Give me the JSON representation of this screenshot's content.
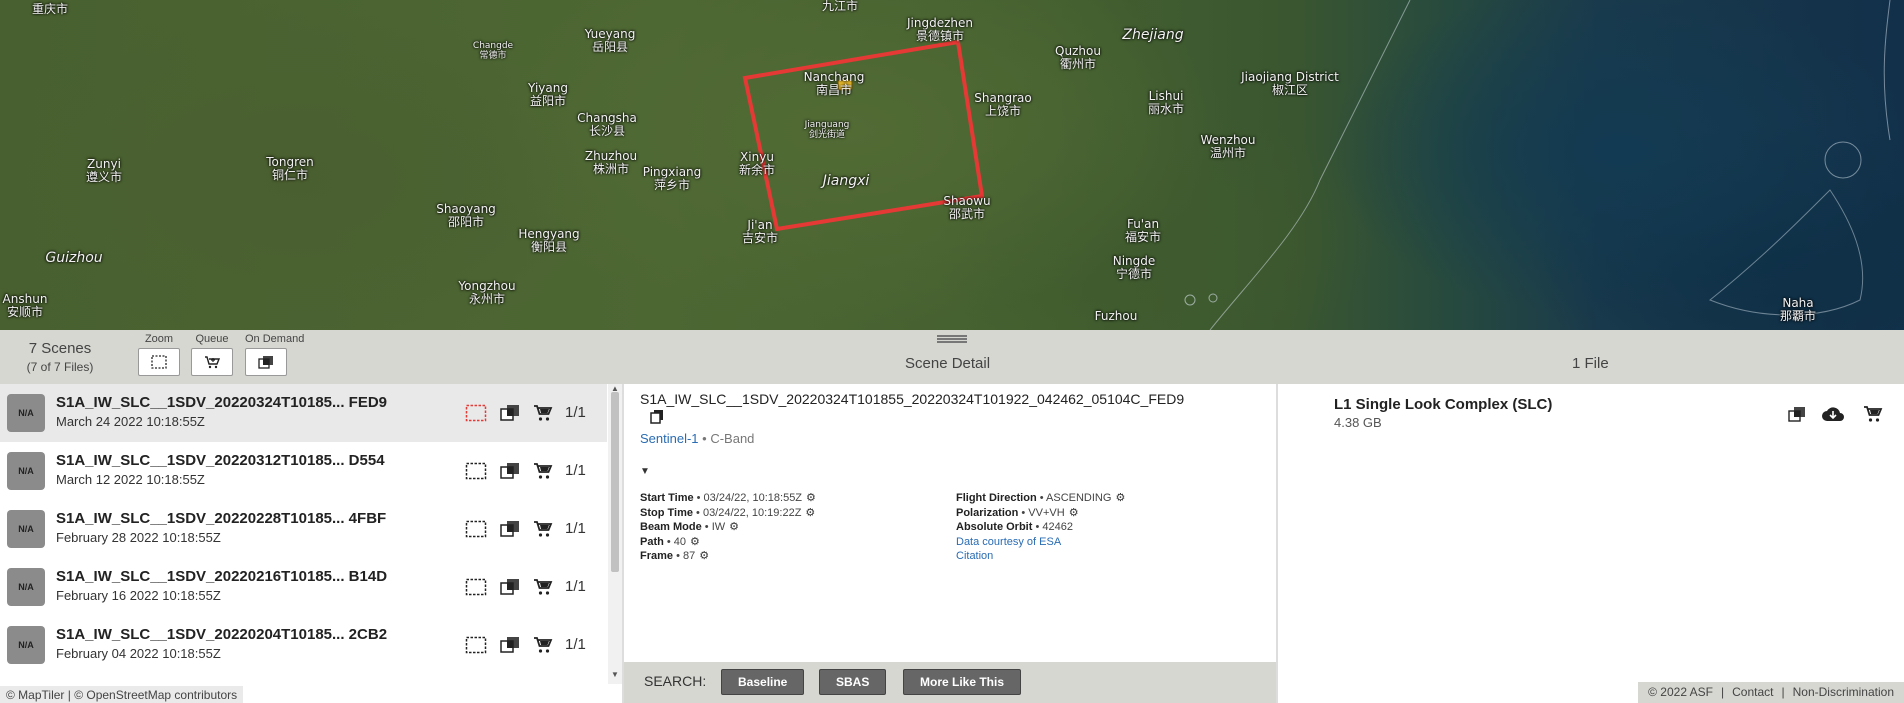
{
  "map": {
    "cities": [
      {
        "name": "重庆市",
        "sm": false
      },
      {
        "name": "Changde\n常德市",
        "sm": true
      },
      {
        "name": "Yueyang\n岳阳县",
        "sm": false
      },
      {
        "name": "九江市",
        "sm": false
      },
      {
        "name": "Jingdezhen\n景德镇市",
        "sm": false
      },
      {
        "name": "Quzhou\n衢州市",
        "sm": false
      },
      {
        "name": "Zhejiang",
        "sm": false,
        "prov": true
      },
      {
        "name": "Yiyang\n益阳市",
        "sm": false
      },
      {
        "name": "Nanchang\n南昌市",
        "sm": false
      },
      {
        "name": "Shangrao\n上饶市",
        "sm": false
      },
      {
        "name": "Lishui\n丽水市",
        "sm": false
      },
      {
        "name": "Jiaojiang District\n椒江区",
        "sm": false
      },
      {
        "name": "Changsha\n长沙县",
        "sm": false
      },
      {
        "name": "Jianguang\n剑光街道",
        "sm": true
      },
      {
        "name": "Wenzhou\n温州市",
        "sm": false
      },
      {
        "name": "Zunyi\n遵义市",
        "sm": false
      },
      {
        "name": "Tongren\n铜仁市",
        "sm": false
      },
      {
        "name": "Zhuzhou\n株洲市",
        "sm": false
      },
      {
        "name": "Pingxiang\n萍乡市",
        "sm": false
      },
      {
        "name": "Xinyu\n新余市",
        "sm": false
      },
      {
        "name": "Jiangxi",
        "sm": false,
        "prov": true
      },
      {
        "name": "Shaoyang\n邵阳市",
        "sm": false
      },
      {
        "name": "Shaowu\n邵武市",
        "sm": false
      },
      {
        "name": "Fu'an\n福安市",
        "sm": false
      },
      {
        "name": "Guizhou",
        "sm": false,
        "prov": true
      },
      {
        "name": "Hengyang\n衡阳县",
        "sm": false
      },
      {
        "name": "Ji'an\n吉安市",
        "sm": false
      },
      {
        "name": "Ningde\n宁德市",
        "sm": false
      },
      {
        "name": "Anshun\n安顺市",
        "sm": false
      },
      {
        "name": "Yongzhou\n永州市",
        "sm": false
      },
      {
        "name": "Fuzhou",
        "sm": false
      },
      {
        "name": "Naha\n那覇市",
        "sm": false
      }
    ],
    "attribution": [
      "© MapTiler",
      "© OpenStreetMap contributors"
    ],
    "footprint_color": "#e53935"
  },
  "toolbar": {
    "scene_count": "7 Scenes",
    "file_count": "(7 of 7 Files)",
    "zoom_label": "Zoom",
    "queue_label": "Queue",
    "ondemand_label": "On Demand",
    "scene_detail_title": "Scene Detail",
    "files_title": "1 File"
  },
  "scenes": [
    {
      "name": "S1A_IW_SLC__1SDV_20220324T10185... FED9",
      "date": "March 24 2022 10:18:55Z",
      "count": "1/1",
      "thumb": "N/A",
      "selected": true
    },
    {
      "name": "S1A_IW_SLC__1SDV_20220312T10185... D554",
      "date": "March 12 2022 10:18:55Z",
      "count": "1/1",
      "thumb": "N/A",
      "selected": false
    },
    {
      "name": "S1A_IW_SLC__1SDV_20220228T10185... 4FBF",
      "date": "February 28 2022 10:18:55Z",
      "count": "1/1",
      "thumb": "N/A",
      "selected": false
    },
    {
      "name": "S1A_IW_SLC__1SDV_20220216T10185... B14D",
      "date": "February 16 2022 10:18:55Z",
      "count": "1/1",
      "thumb": "N/A",
      "selected": false
    },
    {
      "name": "S1A_IW_SLC__1SDV_20220204T10185... 2CB2",
      "date": "February 04 2022 10:18:55Z",
      "count": "1/1",
      "thumb": "N/A",
      "selected": false
    }
  ],
  "detail": {
    "full_name": "S1A_IW_SLC__1SDV_20220324T101855_20220324T101922_042462_05104C_FED9",
    "mission": "Sentinel-1",
    "band": " • C-Band",
    "toggle": "▼",
    "left_props": [
      {
        "k": "Start Time",
        "v": " • 03/24/22, 10:18:55Z"
      },
      {
        "k": "Stop Time",
        "v": " • 03/24/22, 10:19:22Z"
      },
      {
        "k": "Beam Mode",
        "v": " • IW"
      },
      {
        "k": "Path",
        "v": " • 40"
      },
      {
        "k": "Frame",
        "v": " • 87"
      }
    ],
    "right_props": [
      {
        "k": "Flight Direction",
        "v": " • ASCENDING"
      },
      {
        "k": "Polarization",
        "v": " • VV+VH"
      },
      {
        "k": "Absolute Orbit",
        "v": " • 42462"
      }
    ],
    "links": [
      "Data courtesy of ESA",
      "Citation"
    ]
  },
  "search": {
    "label": "SEARCH:",
    "buttons": [
      "Baseline",
      "SBAS",
      "More Like This"
    ]
  },
  "files": {
    "name": "L1 Single Look Complex (SLC)",
    "size": "4.38 GB"
  },
  "footer": [
    "© 2022 ASF",
    "|",
    "Contact",
    "|",
    "Non-Discrimination"
  ]
}
